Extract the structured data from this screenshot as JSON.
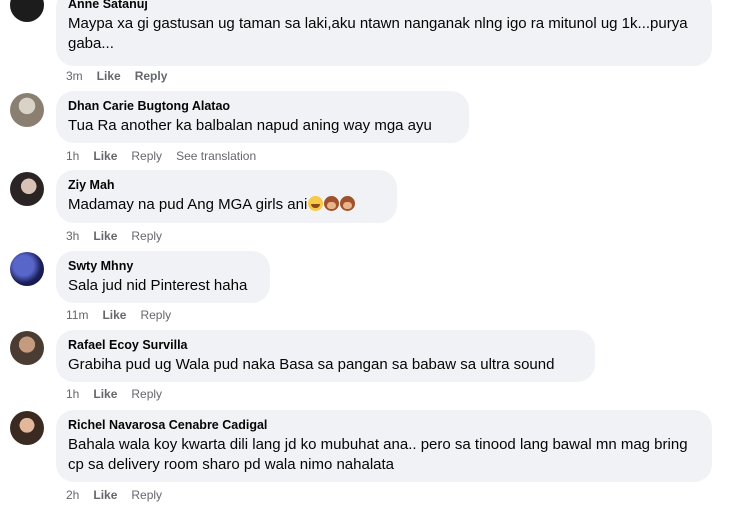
{
  "comments": [
    {
      "author": "Anne Satanuj",
      "text": "Maypa xa gi gastusan ug taman sa laki,aku ntawn nanganak nlng igo ra mitunol ug 1k...purya gaba...",
      "time": "3m",
      "like": "Like",
      "reply": "Reply"
    },
    {
      "author": "Dhan Carie Bugtong Alatao",
      "text": "Tua Ra another ka balbalan napud aning way mga ayu",
      "time": "1h",
      "like": "Like",
      "reply": "Reply",
      "translate": "See translation"
    },
    {
      "author": "Ziy Mah",
      "text": "Madamay na pud Ang MGA girls ani",
      "emojis": [
        "grinning-sweat-emoji",
        "see-no-evil-monkey-emoji",
        "see-no-evil-monkey-emoji"
      ],
      "time": "3h",
      "like": "Like",
      "reply": "Reply"
    },
    {
      "author": "Swty Mhny",
      "text": "Sala jud nid Pinterest haha",
      "time": "11m",
      "like": "Like",
      "reply": "Reply"
    },
    {
      "author": "Rafael Ecoy Survilla",
      "text": "Grabiha pud ug Wala pud naka Basa sa pangan sa babaw sa ultra sound",
      "time": "1h",
      "like": "Like",
      "reply": "Reply"
    },
    {
      "author": "Richel Navarosa Cenabre Cadigal",
      "text": "Bahala wala koy kwarta dili lang jd ko mubuhat ana.. pero sa tinood lang bawal mn mag bring cp sa delivery room sharo pd wala nimo nahalata",
      "time": "2h",
      "like": "Like",
      "reply": "Reply"
    }
  ],
  "colors": {
    "bubble": "#f0f2f5",
    "meta": "#65676b",
    "text": "#050505"
  }
}
